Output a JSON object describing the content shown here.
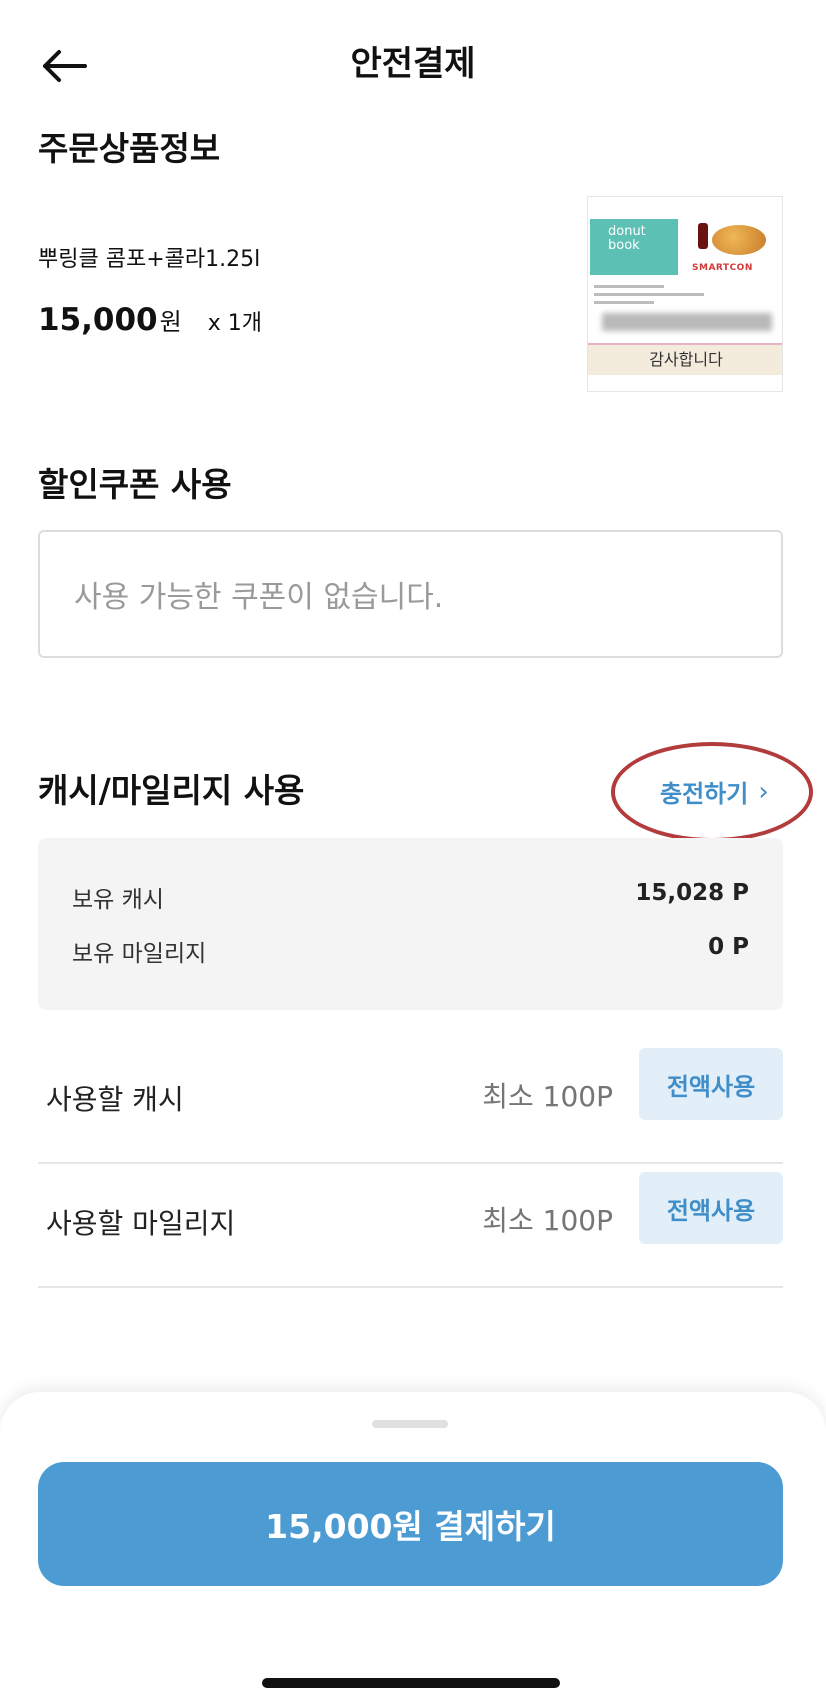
{
  "header": {
    "title": "안전결제",
    "back_icon": "arrow-left-icon"
  },
  "order": {
    "section_title": "주문상품정보",
    "product_name": "뿌링클 콤포+콜라1.25l",
    "price": "15,000",
    "price_unit": "원",
    "quantity": "x 1개",
    "card": {
      "logo_line1": "donut",
      "logo_line2": "book",
      "brand": "SMARTCON",
      "banner": "감사합니다"
    }
  },
  "coupon": {
    "section_title": "할인쿠폰 사용",
    "placeholder": "사용 가능한 쿠폰이 없습니다."
  },
  "cash": {
    "section_title": "캐시/마일리지 사용",
    "charge_label": "충전하기",
    "balance": {
      "cash_label": "보유 캐시",
      "cash_value": "15,028 P",
      "mileage_label": "보유 마일리지",
      "mileage_value": "0 P"
    },
    "use_cash": {
      "label": "사용할 캐시",
      "placeholder": "최소 100P",
      "button": "전액사용"
    },
    "use_mileage": {
      "label": "사용할 마일리지",
      "placeholder": "최소 100P",
      "button": "전액사용"
    }
  },
  "footer": {
    "pay_button": "15,000원 결제하기"
  },
  "colors": {
    "accent": "#4d9bd3",
    "link": "#3f8ec9",
    "highlight": "#b23b3b"
  }
}
